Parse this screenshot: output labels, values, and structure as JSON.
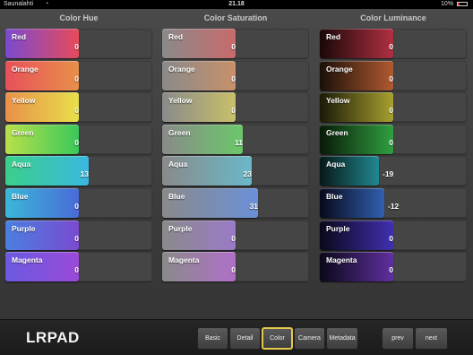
{
  "status": {
    "carrier": "Saunalahti",
    "wifi": "◔",
    "time": "21.18",
    "battery": "10%"
  },
  "columns": [
    {
      "title": "Color Hue",
      "rows": [
        {
          "label": "Red",
          "value": "0",
          "fill": 0.5,
          "gradient": "linear-gradient(90deg,#7a4ad0,#e84a5a)"
        },
        {
          "label": "Orange",
          "value": "0",
          "fill": 0.5,
          "gradient": "linear-gradient(90deg,#e8505a,#e8904a)"
        },
        {
          "label": "Yellow",
          "value": "0",
          "fill": 0.5,
          "gradient": "linear-gradient(90deg,#e8904a,#e8e04a)"
        },
        {
          "label": "Green",
          "value": "0",
          "fill": 0.5,
          "gradient": "linear-gradient(90deg,#b8e04a,#3ac85a)"
        },
        {
          "label": "Aqua",
          "value": "13",
          "fill": 0.57,
          "gradient": "linear-gradient(90deg,#3ad08a,#3ab8e0)"
        },
        {
          "label": "Blue",
          "value": "0",
          "fill": 0.5,
          "gradient": "linear-gradient(90deg,#3ab8d8,#4a6ad8)"
        },
        {
          "label": "Purple",
          "value": "0",
          "fill": 0.5,
          "gradient": "linear-gradient(90deg,#4a80e0,#7a4ad0)"
        },
        {
          "label": "Magenta",
          "value": "0",
          "fill": 0.5,
          "gradient": "linear-gradient(90deg,#6a5ae0,#9a4ad8)"
        }
      ]
    },
    {
      "title": "Color Saturation",
      "rows": [
        {
          "label": "Red",
          "value": "0",
          "fill": 0.5,
          "gradient": "linear-gradient(90deg,#8a8a8a,#c86a6a)"
        },
        {
          "label": "Orange",
          "value": "0",
          "fill": 0.5,
          "gradient": "linear-gradient(90deg,#8a8a8a,#c8906a)"
        },
        {
          "label": "Yellow",
          "value": "0",
          "fill": 0.5,
          "gradient": "linear-gradient(90deg,#8a8a8a,#c8c06a)"
        },
        {
          "label": "Green",
          "value": "11",
          "fill": 0.55,
          "gradient": "linear-gradient(90deg,#8a8a8a,#6ac86a)"
        },
        {
          "label": "Aqua",
          "value": "23",
          "fill": 0.61,
          "gradient": "linear-gradient(90deg,#8a8a8a,#6ab8c8)"
        },
        {
          "label": "Blue",
          "value": "31",
          "fill": 0.65,
          "gradient": "linear-gradient(90deg,#8a8a8a,#6a90d8)"
        },
        {
          "label": "Purple",
          "value": "0",
          "fill": 0.5,
          "gradient": "linear-gradient(90deg,#8a8a8a,#9a7ac8)"
        },
        {
          "label": "Magenta",
          "value": "0",
          "fill": 0.5,
          "gradient": "linear-gradient(90deg,#8a8a8a,#b070c8)"
        }
      ]
    },
    {
      "title": "Color Luminance",
      "rows": [
        {
          "label": "Red",
          "value": "0",
          "fill": 0.5,
          "gradient": "linear-gradient(90deg,#1a0808,#b03040)"
        },
        {
          "label": "Orange",
          "value": "0",
          "fill": 0.5,
          "gradient": "linear-gradient(90deg,#1a1008,#b05a30)"
        },
        {
          "label": "Yellow",
          "value": "0",
          "fill": 0.5,
          "gradient": "linear-gradient(90deg,#1a1a08,#a8a030)"
        },
        {
          "label": "Green",
          "value": "0",
          "fill": 0.5,
          "gradient": "linear-gradient(90deg,#081a08,#30a040)"
        },
        {
          "label": "Aqua",
          "value": "-19",
          "fill": 0.4,
          "gradient": "linear-gradient(90deg,#081818,#208890)"
        },
        {
          "label": "Blue",
          "value": "-12",
          "fill": 0.44,
          "gradient": "linear-gradient(90deg,#08081a,#3060b0)"
        },
        {
          "label": "Purple",
          "value": "0",
          "fill": 0.5,
          "gradient": "linear-gradient(90deg,#0a081a,#4030b0)"
        },
        {
          "label": "Magenta",
          "value": "0",
          "fill": 0.5,
          "gradient": "linear-gradient(90deg,#0a0818,#6030a0)"
        }
      ]
    }
  ],
  "toolbar": {
    "logo": "LRPAD",
    "tabs": [
      {
        "label": "Basic",
        "active": false
      },
      {
        "label": "Detail",
        "active": false
      },
      {
        "label": "Color",
        "active": true
      },
      {
        "label": "Camera",
        "active": false
      },
      {
        "label": "Metadata",
        "active": false
      }
    ],
    "prev_label": "prev",
    "next_label": "next"
  }
}
